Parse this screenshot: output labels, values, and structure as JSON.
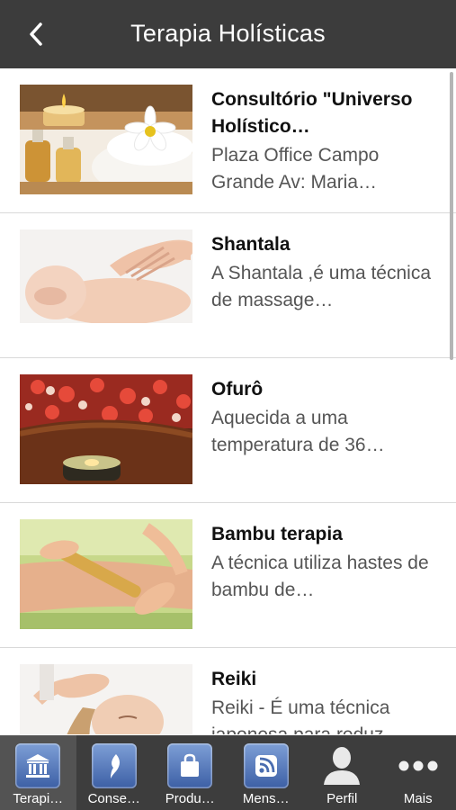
{
  "header": {
    "title": "Terapia Holísticas",
    "back_icon": "chevron-left-icon"
  },
  "items": [
    {
      "title": "Consultório \"Universo Holístico…",
      "description": "Plaza Office Campo Grande Av: Maria…"
    },
    {
      "title": "Shantala",
      "description": "A Shantala ,é uma técnica de massage…"
    },
    {
      "title": "Ofurô",
      "description": "Aquecida a uma temperatura de 36…"
    },
    {
      "title": "Bambu terapia",
      "description": "A técnica utiliza hastes de bambu de…"
    },
    {
      "title": "Reiki",
      "description": "Reiki - É uma técnica japonesa para reduz…"
    }
  ],
  "tabs": [
    {
      "label": "Terapi…",
      "icon": "temple-icon",
      "active": true
    },
    {
      "label": "Conse…",
      "icon": "feather-icon"
    },
    {
      "label": "Produ…",
      "icon": "shopping-bag-icon"
    },
    {
      "label": "Mens…",
      "icon": "rss-icon"
    },
    {
      "label": "Perfil",
      "icon": "user-icon"
    },
    {
      "label": "Mais",
      "icon": "more-icon"
    }
  ],
  "colors": {
    "navbar": "#3c3c3c",
    "tabbar": "#3d3d3d",
    "tab_icon_blue": "#4a6db0"
  }
}
